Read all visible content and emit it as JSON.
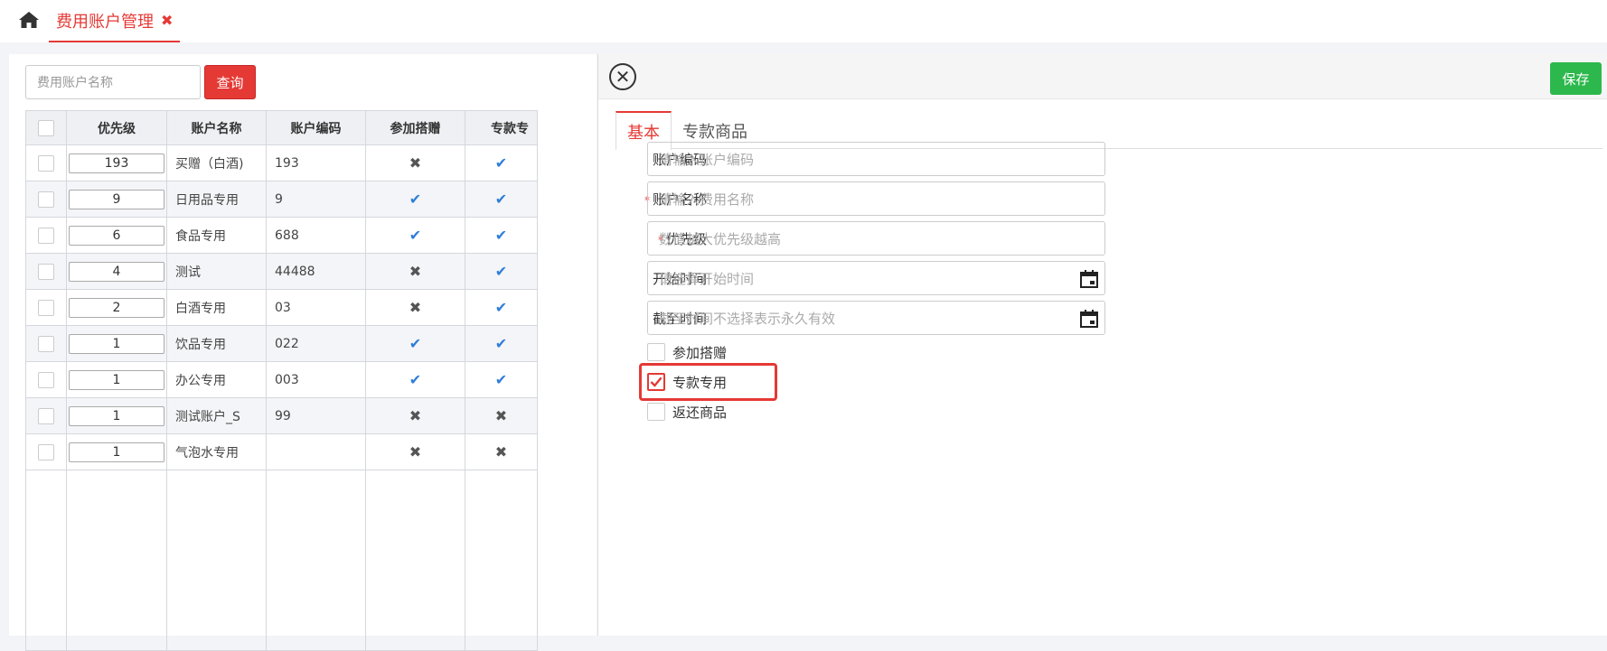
{
  "topbar": {
    "home_icon": "home-icon",
    "active_tab_label": "费用账户管理",
    "active_tab_close": "✖",
    "accent_color": "#e53935"
  },
  "search": {
    "placeholder": "费用账户名称",
    "button_label": "查询"
  },
  "table": {
    "columns": [
      "优先级",
      "账户名称",
      "账户编码",
      "参加搭赠",
      "专款专"
    ],
    "rows": [
      {
        "priority": "193",
        "name": "买赠（白酒)",
        "code": "193",
        "gift": "✖",
        "special": "✔"
      },
      {
        "priority": "9",
        "name": "日用品专用",
        "code": "9",
        "gift": "✔",
        "special": "✔"
      },
      {
        "priority": "6",
        "name": "食品专用",
        "code": "688",
        "gift": "✔",
        "special": "✔"
      },
      {
        "priority": "4",
        "name": "测试",
        "code": "44488",
        "gift": "✖",
        "special": "✔"
      },
      {
        "priority": "2",
        "name": "白酒专用",
        "code": "03",
        "gift": "✖",
        "special": "✔"
      },
      {
        "priority": "1",
        "name": "饮品专用",
        "code": "022",
        "gift": "✔",
        "special": "✔"
      },
      {
        "priority": "1",
        "name": "办公专用",
        "code": "003",
        "gift": "✔",
        "special": "✔"
      },
      {
        "priority": "1",
        "name": "测试账户_S",
        "code": "99",
        "gift": "✖",
        "special": "✖"
      },
      {
        "priority": "1",
        "name": "气泡水专用",
        "code": "",
        "gift": "✖",
        "special": "✖"
      }
    ]
  },
  "editor": {
    "close_label": "✕",
    "save_label": "保存",
    "save_color": "#2db84d",
    "tabs": [
      "基本",
      "专款商品"
    ],
    "fields": [
      {
        "label": "账户编码",
        "required": false,
        "placeholder": "请输入账户编码"
      },
      {
        "label": "账户名称",
        "required": true,
        "placeholder": "请输入费用名称"
      },
      {
        "label": "优先级",
        "required": true,
        "placeholder": "数值越大优先级越高"
      },
      {
        "label": "开始时间",
        "required": false,
        "placeholder": "请选择开始时间"
      },
      {
        "label": "截至时间",
        "required": false,
        "placeholder": "截至时间不选择表示永久有效"
      }
    ],
    "required_mark": "*",
    "checkboxes": [
      {
        "label": "参加搭赠",
        "checked": false
      },
      {
        "label": "专款专用",
        "checked": true
      },
      {
        "label": "返还商品",
        "checked": false
      }
    ]
  }
}
